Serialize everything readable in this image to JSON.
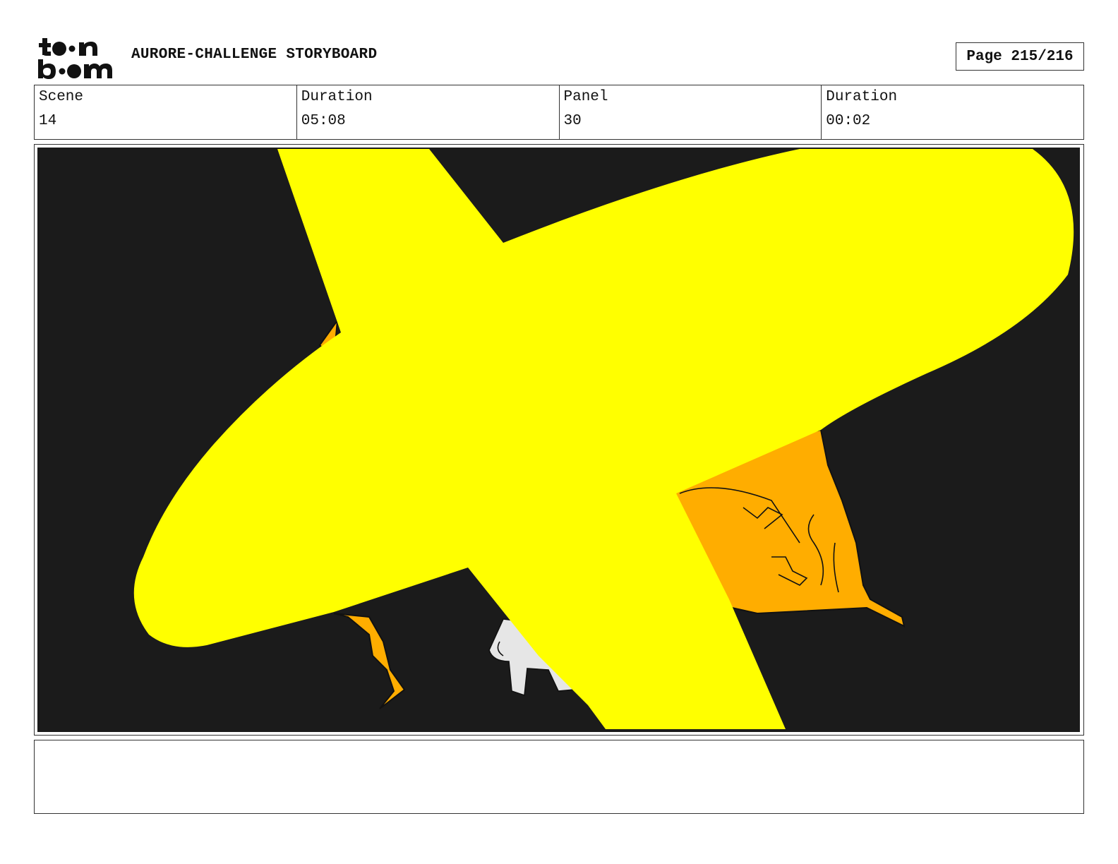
{
  "header": {
    "logo_name": "toon boom logo",
    "title": "AURORE-CHALLENGE STORYBOARD",
    "page": "Page 215/216"
  },
  "info": {
    "scene_label": "Scene",
    "scene_value": "14",
    "scene_duration_label": "Duration",
    "scene_duration_value": "05:08",
    "panel_label": "Panel",
    "panel_value": "30",
    "panel_duration_label": "Duration",
    "panel_duration_value": "00:02"
  },
  "panel": {
    "colors": {
      "background": "#1b1b1b",
      "cross_mark": "#ffff00",
      "creature": "#ffad00",
      "figure": "#e6e6e6"
    }
  },
  "notes": {
    "text": ""
  }
}
